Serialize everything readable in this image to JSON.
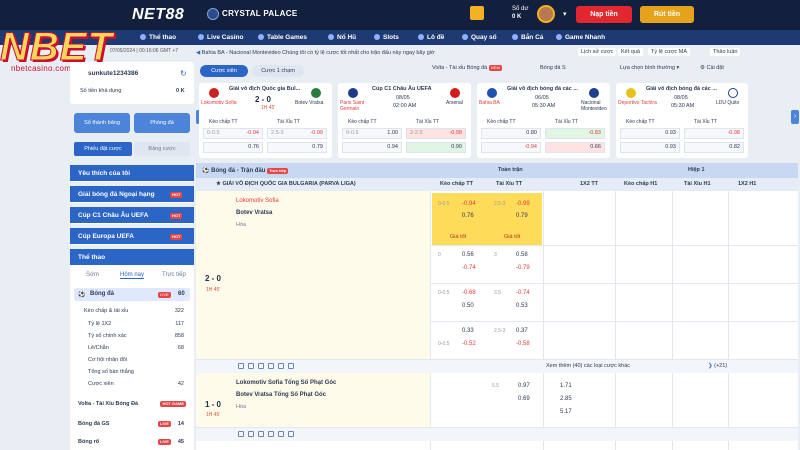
{
  "brand": {
    "net88": "NET88",
    "crystal": "CRYSTAL PALACE",
    "watermark": "NBET",
    "watermark_sub": "nbetcasino.com"
  },
  "header": {
    "balance_label": "Số dư",
    "balance_value": "0 K",
    "deposit": "Nạp tiền",
    "withdraw": "Rút tiền"
  },
  "nav": [
    "Thể thao",
    "Live Casino",
    "Table Games",
    "Nổ Hũ",
    "Slots",
    "Lô đề",
    "Quay số",
    "Bắn Cá",
    "Game Nhanh"
  ],
  "ticker": {
    "label": "Bahia BA - Nacional Montevideo Chúng tôi có tỷ lệ cược tốt nhất cho trận đấu này ngay bây giờ"
  },
  "tabs": {
    "lich_su": "Lịch sử cược",
    "ket_qua": "Kết quả",
    "ty_le": "Tỷ lệ cược MA",
    "thao_luan": "Thảo luận"
  },
  "user": {
    "id": "sunkute1234386",
    "date": "07/05/2024 | 00:16:06 GMT +7",
    "credit_label": "Số tiền khả dụng",
    "credit": "0 K",
    "btn_bet": "Số thành bảng",
    "btn_room": "Phòng đá",
    "tab1": "Phiếu đặt cược",
    "tab2": "Bảng cược"
  },
  "filters": {
    "cuoc_xien": "Cược xiên",
    "cuoc_1": "Cược 1 chạm",
    "volta": "Volta - Tài xỉu Bóng đá",
    "volta_tag": "NEW",
    "bong_da_s": "Bóng đá S",
    "chon": "Lựa chọn bình thường",
    "cai_dat": "Cài đặt"
  },
  "sidebar": {
    "fav": "Yêu thích của tôi",
    "nha": "Giải bóng đá Ngoại hạng",
    "c1": "Cúp C1 Châu Âu UEFA",
    "europa": "Cúp Europa UEFA",
    "sport": "Thể thao",
    "tab_som": "Sớm",
    "tab_hom_nay": "Hôm nay",
    "tab_truc_tiep": "Trực tiếp",
    "bong_da": "Bóng đá",
    "bong_da_cnt": "60",
    "bong_da_tag": "LIVE",
    "items": [
      {
        "label": "Kèo chấp & tài xỉu",
        "count": "322"
      },
      {
        "label": "Tỷ lệ 1X2",
        "count": "117"
      },
      {
        "label": "Tỷ số chính xác",
        "count": "858"
      },
      {
        "label": "Lẻ/Chẵn",
        "count": "68"
      },
      {
        "label": "Cơ hội nhân đôi",
        "count": ""
      },
      {
        "label": "Tổng số bàn thắng",
        "count": ""
      },
      {
        "label": "Cược xiên",
        "count": "42"
      }
    ],
    "volta": "Volta - Tài Xỉu Bóng Đá",
    "volta_tag": "HOT GAME",
    "bd_gs": "Bóng đá GS",
    "bd_gs_cnt": "14",
    "bong_ro": "Bóng rổ",
    "bong_ro_cnt": "45"
  },
  "cards": [
    {
      "league": "Giải vô địch Quốc gia Bul...",
      "home": "Lokomotiv Sofia",
      "away": "Botev Vratsa",
      "score": "2 - 0",
      "time": "1H 45'",
      "h1": "-0.94",
      "h2": "-0.99",
      "r1": "0.76",
      "r2": "0.79",
      "lh": "Kèo chấp TT",
      "lt": "Tài Xỉu TT",
      "c1": "0-0.5",
      "c2": "2.5-3"
    },
    {
      "league": "Cúp C1 Châu Âu UEFA",
      "home": "Paris Saint Germain",
      "away": "Arsenal",
      "score": "08/05",
      "time": "02:00 AM",
      "h1": "1.00",
      "h2": "-0.98",
      "r1": "0.94",
      "r2": "0.90",
      "lh": "Kèo chấp TT",
      "lt": "Tài Xỉu TT",
      "c1": "0-0.5",
      "c2": "2-2.5"
    },
    {
      "league": "Giải vô địch bóng đá các ...",
      "home": "Bahia BA",
      "away": "Nacional Montevideo",
      "score": "06/05",
      "time": "05:30 AM",
      "h1": "0.80",
      "h2": "-0.83",
      "r1": "-0.94",
      "r2": "0.66",
      "lh": "Kèo chấp TT",
      "lt": "Tài Xỉu TT",
      "c1": "",
      "c2": ""
    },
    {
      "league": "Giải vô địch bóng đá các ...",
      "home": "Deportivo Tachira",
      "away": "LDU Quito",
      "score": "08/05",
      "time": "05:30 AM",
      "h1": "0.93",
      "h2": "-0.98",
      "r1": "0.93",
      "r2": "0.82",
      "lh": "Kèo chấp TT",
      "lt": "Tài Xỉu TT",
      "c1": "",
      "c2": ""
    }
  ],
  "grid": {
    "sport": "Bóng đá - Trận đấu",
    "live_tag": "Trực tiếp",
    "full": "Toàn trận",
    "half": "Hiệp 1",
    "league": "GIẢI VÔ ĐỊCH QUỐC GIA BULGARIA (PARVA LIGA)",
    "cols": [
      "Kèo chấp TT",
      "Tài Xỉu TT",
      "1X2 TT",
      "Kèo chấp H1",
      "Tài Xỉu H1",
      "1X2 H1"
    ],
    "m1": {
      "home": "Lokomotiv Sofia",
      "away": "Botev Vratsa",
      "draw": "Hòa",
      "score": "2 - 0",
      "time": "1H 45'",
      "gt": "Giá tốt"
    },
    "m1_rows": [
      [
        "0-0.5",
        "-0.94",
        "",
        "0.76",
        "2.5-3",
        "-0.99",
        "",
        "0.79"
      ],
      [
        "0",
        "0.56",
        "",
        "-0.74",
        "3",
        "0.58",
        "",
        "-0.79"
      ],
      [
        "0-0.5",
        "-0.68",
        "",
        "0.50",
        "3.5",
        "-0.74",
        "",
        "0.53"
      ],
      [
        "",
        "0.33",
        "0-0.5",
        "-0.52",
        "2.5-3",
        "0.37",
        "",
        "-0.58"
      ]
    ],
    "more": "Xem thêm (40) các loại cược khác",
    "plus": "(+21)",
    "m2": {
      "home": "Lokomotiv Sofia Tổng Số Phạt Góc",
      "away": "Botev Vratsa Tổng Số Phạt Góc",
      "draw": "Hòa",
      "score": "1 - 0",
      "time": "1H 45'"
    },
    "m2_vals": [
      "5.5",
      "0.97",
      "",
      "0.69",
      "1.71",
      "2.85",
      "5.17"
    ]
  }
}
